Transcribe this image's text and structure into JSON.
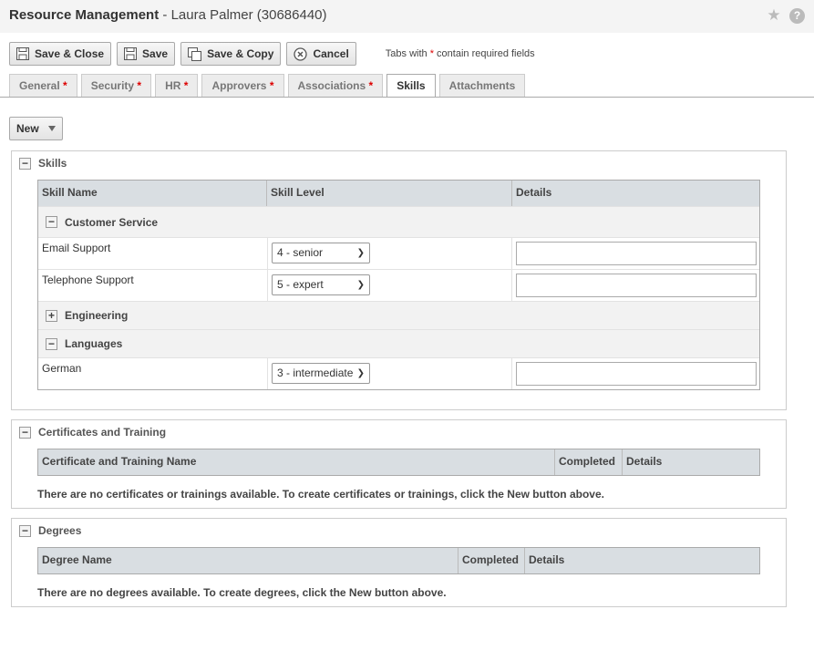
{
  "header": {
    "app_title": "Resource Management",
    "separator": " - ",
    "record": "Laura Palmer (30686440)",
    "star_icon": "star-icon",
    "help_icon": "help-icon",
    "help_glyph": "?"
  },
  "toolbar": {
    "save_close": "Save & Close",
    "save": "Save",
    "save_copy": "Save & Copy",
    "cancel": "Cancel",
    "req_note_pre": "Tabs with ",
    "req_note_star": "*",
    "req_note_post": " contain required fields"
  },
  "tabs": [
    {
      "label": "General",
      "required": "*"
    },
    {
      "label": "Security",
      "required": "*"
    },
    {
      "label": "HR",
      "required": "*"
    },
    {
      "label": "Approvers",
      "required": "*"
    },
    {
      "label": "Associations",
      "required": "*"
    },
    {
      "label": "Skills",
      "required": ""
    },
    {
      "label": "Attachments",
      "required": ""
    }
  ],
  "active_tab": "Skills",
  "new_button": "New",
  "skills": {
    "title": "Skills",
    "columns": [
      "Skill Name",
      "Skill Level",
      "Details"
    ],
    "groups": {
      "customer_service": {
        "label": "Customer Service",
        "rows": [
          {
            "name": "Email Support",
            "level": "4 - senior",
            "details": ""
          },
          {
            "name": "Telephone Support",
            "level": "5 - expert",
            "details": ""
          }
        ]
      },
      "engineering": {
        "label": "Engineering"
      },
      "languages": {
        "label": "Languages",
        "rows": [
          {
            "name": "German",
            "level": "3 - intermediate",
            "details": ""
          }
        ]
      }
    }
  },
  "certificates": {
    "title": "Certificates and Training",
    "columns": [
      "Certificate and Training Name",
      "Completed",
      "Details"
    ],
    "empty": "There are no certificates or trainings available. To create certificates or trainings, click the New button above."
  },
  "degrees": {
    "title": "Degrees",
    "columns": [
      "Degree Name",
      "Completed",
      "Details"
    ],
    "empty": "There are no degrees available. To create degrees, click the New button above."
  },
  "colors": {
    "grid_header": "#d9dee2",
    "group_row": "#f2f2f2",
    "required_star": "#dd0000"
  }
}
